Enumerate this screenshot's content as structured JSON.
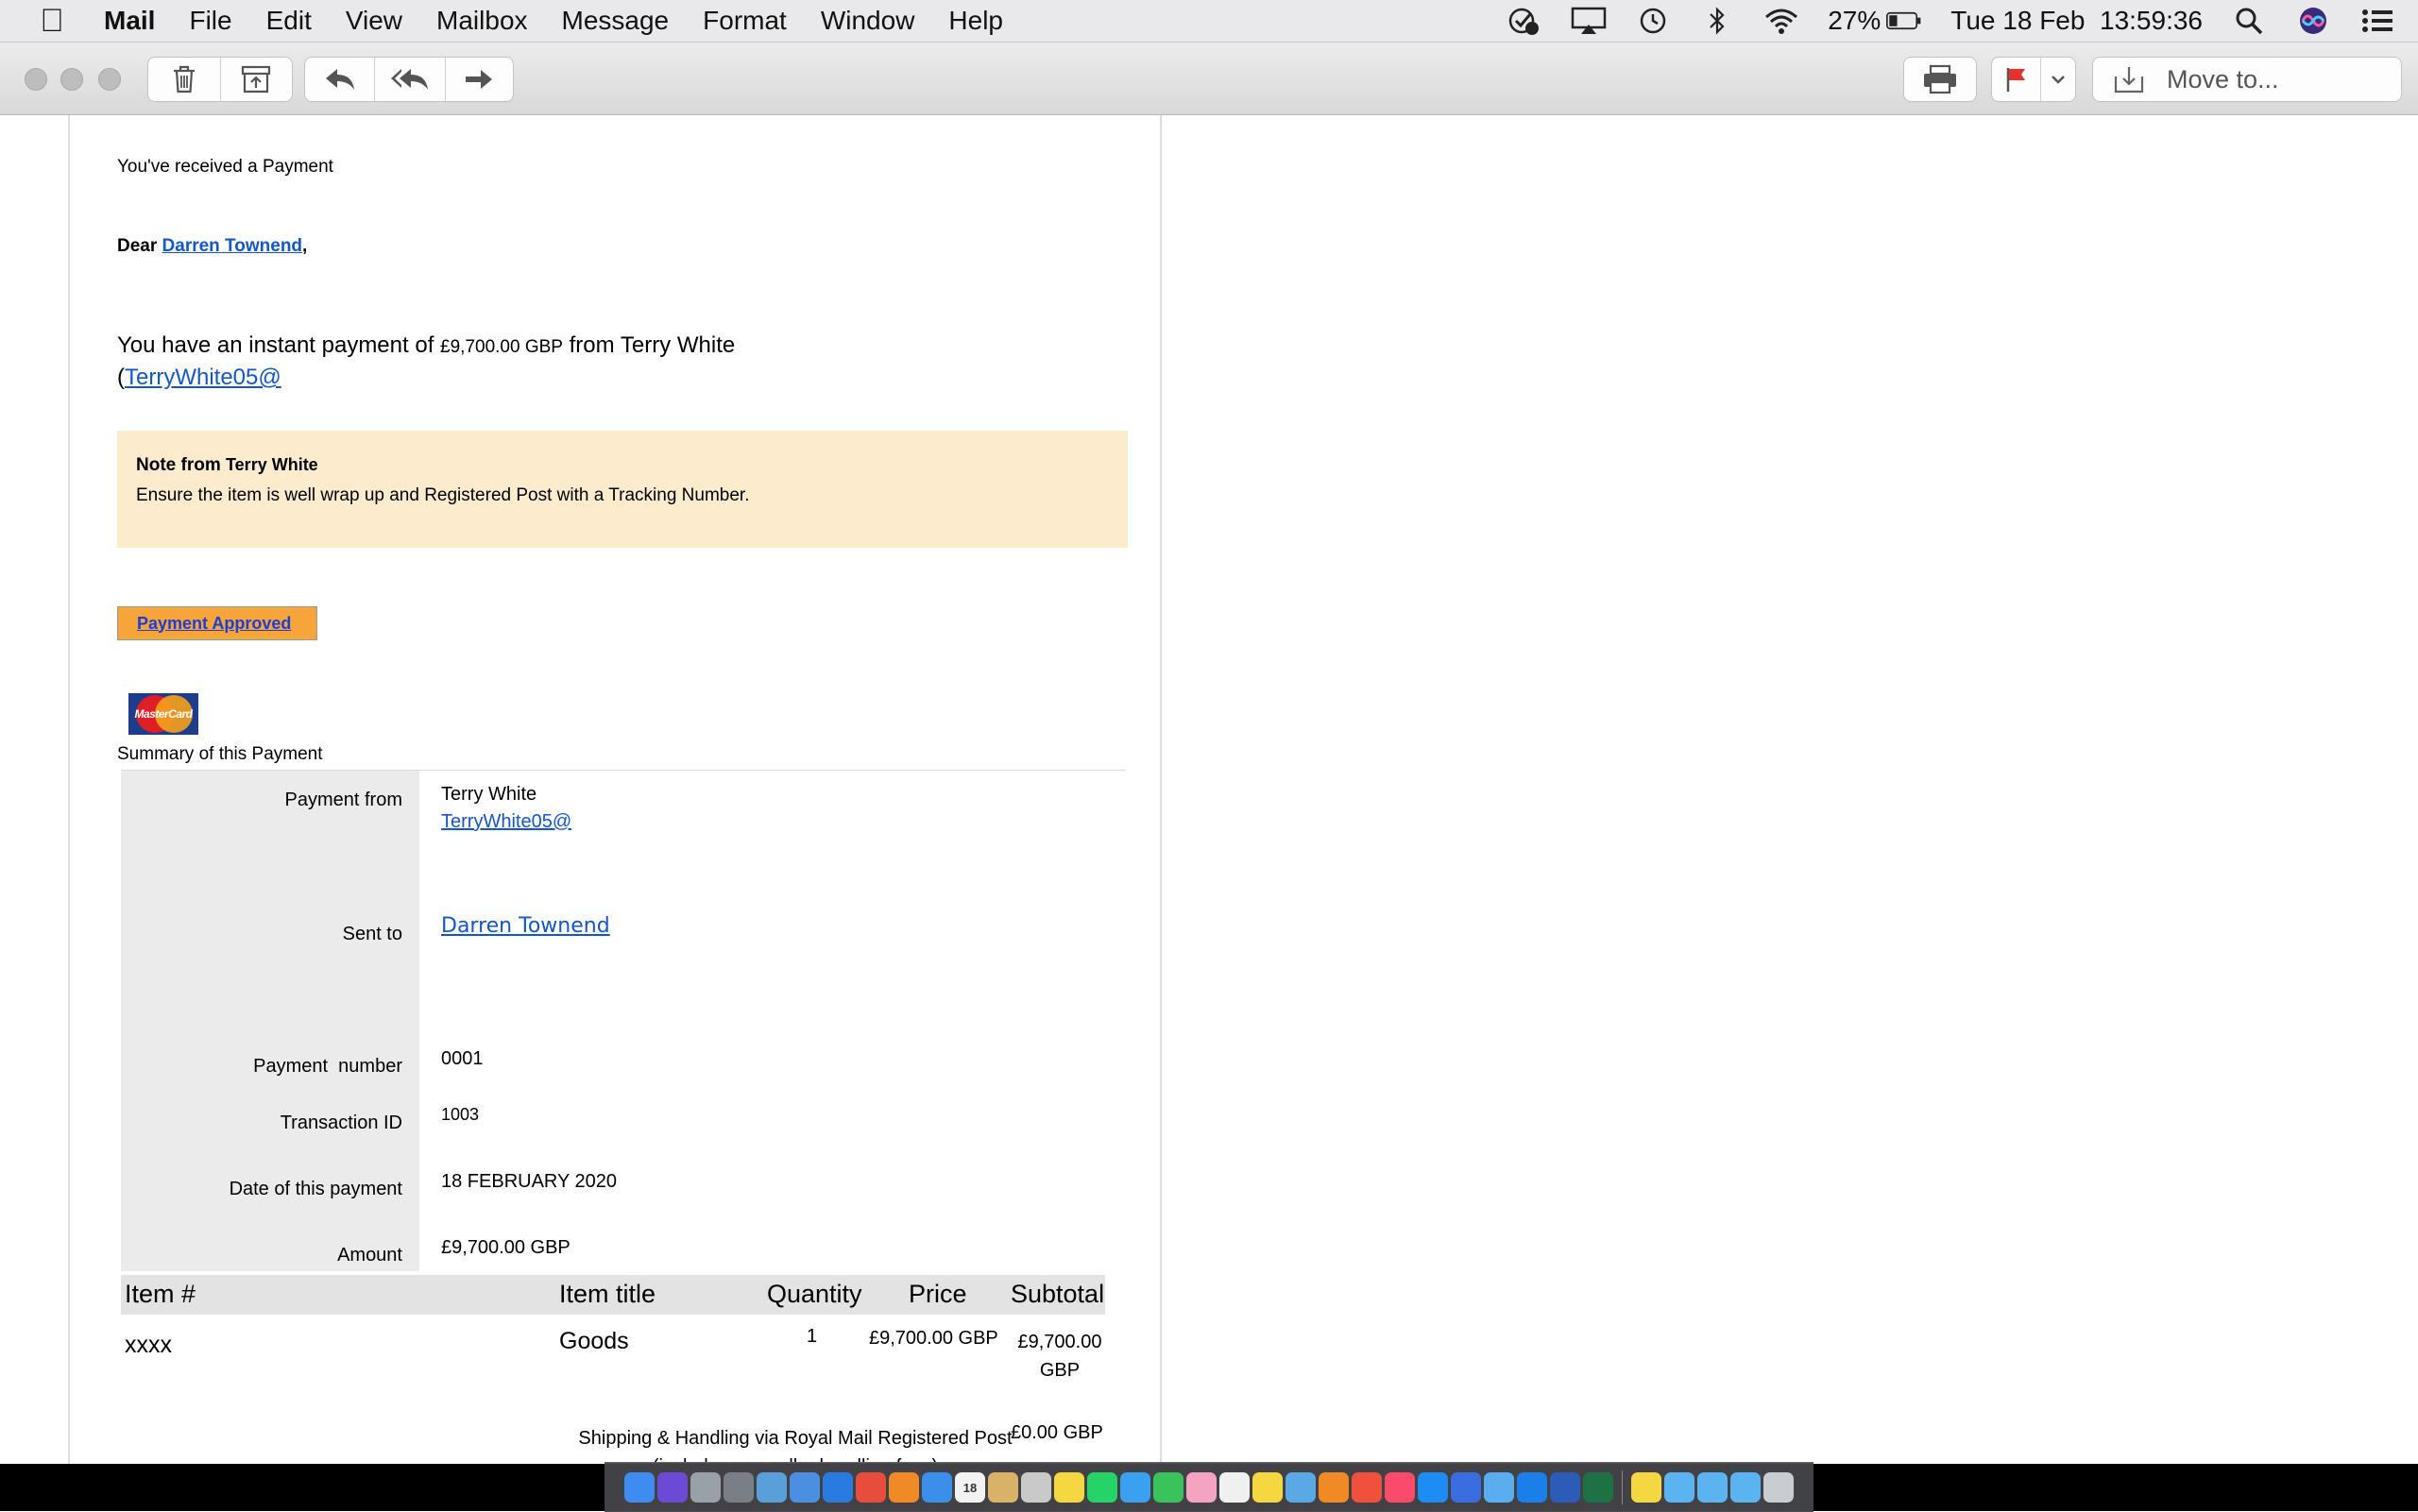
{
  "menubar": {
    "app_name": "Mail",
    "menus": [
      "File",
      "Edit",
      "View",
      "Mailbox",
      "Message",
      "Format",
      "Window",
      "Help"
    ],
    "battery_percent": "27%",
    "datetime": "Tue 18 Feb  13:59:36",
    "status_icons": [
      "checkmark-badge-icon",
      "airplay-icon",
      "time-machine-icon",
      "bluetooth-icon",
      "wifi-icon",
      "battery-icon"
    ],
    "right_icons": [
      "spotlight-search-icon",
      "siri-icon",
      "notification-center-icon"
    ]
  },
  "toolbar": {
    "buttons": [
      "delete",
      "archive",
      "reply",
      "reply-all",
      "forward",
      "print",
      "flag"
    ],
    "move_to_label": "Move to...",
    "flag_color": "#e8312c"
  },
  "email": {
    "heading": "You've received a Payment",
    "greeting_prefix": "Dear",
    "recipient_name": "Darren Townend",
    "greeting_suffix": ",",
    "intro_text": "You have an instant payment of",
    "amount_inline": "£9,700.00 GBP",
    "intro_from": "from Terry White",
    "sender_email_open": "(",
    "sender_email": "TerryWhite05@",
    "note_title": "Note from",
    "note_author": "Terry White",
    "note_body": "Ensure the item is well wrap up and Registered Post with a Tracking Number.",
    "approved_button": "Payment Approved",
    "card_logo_text": "MasterCard",
    "summary_title": "Summary of this Payment",
    "summary": {
      "payment_from_label": "Payment from",
      "payment_from_name": "Terry White",
      "payment_from_email": "TerryWhite05@",
      "sent_to_label": "Sent to",
      "sent_to_value": "Darren Townend",
      "payment_number_label": "Payment  number",
      "payment_number_value": "0001",
      "transaction_id_label": "Transaction ID",
      "transaction_id_value": "1003",
      "date_label": "Date of this payment",
      "date_value": "18 FEBRUARY 2020",
      "amount_label": "Amount",
      "amount_value": "£9,700.00 GBP"
    },
    "items_table": {
      "headers": {
        "item": "Item #",
        "title": "Item title",
        "quantity": "Quantity",
        "price": "Price",
        "subtotal": "Subtotal"
      },
      "rows": [
        {
          "item": "xxxx",
          "title": "Goods",
          "quantity": "1",
          "price": "£9,700.00 GBP",
          "subtotal_line1": "£9,700.00",
          "subtotal_line2": "GBP"
        }
      ],
      "shipping_label": "Shipping & Handling via Royal Mail Registered Post",
      "shipping_note": "(includes any seller handling fees)",
      "shipping_value": "£0.00 GBP"
    }
  },
  "dock": {
    "apps": [
      "finder-icon",
      "siri-icon",
      "launchpad-icon",
      "system-preferences-icon",
      "preview-icon",
      "mail-icon",
      "safari-icon",
      "chrome-icon",
      "firefox-icon",
      "xcode-icon",
      "calendar-icon",
      "notes-icon",
      "notes-icon-2",
      "stickies-icon",
      "whatsapp-icon",
      "messages-icon",
      "facetime-icon",
      "photos-icon",
      "textedit-icon",
      "stickies-icon-2",
      "folder-icon",
      "books-icon",
      "news-icon",
      "music-icon",
      "app-store-icon",
      "security-icon",
      "vpn-icon",
      "teamviewer-icon",
      "word-icon",
      "excel-icon",
      "notes-icon-3",
      "downloads-folder-icon",
      "documents-folder-icon",
      "applications-folder-icon",
      "trash-icon"
    ],
    "calendar_day": "18"
  }
}
